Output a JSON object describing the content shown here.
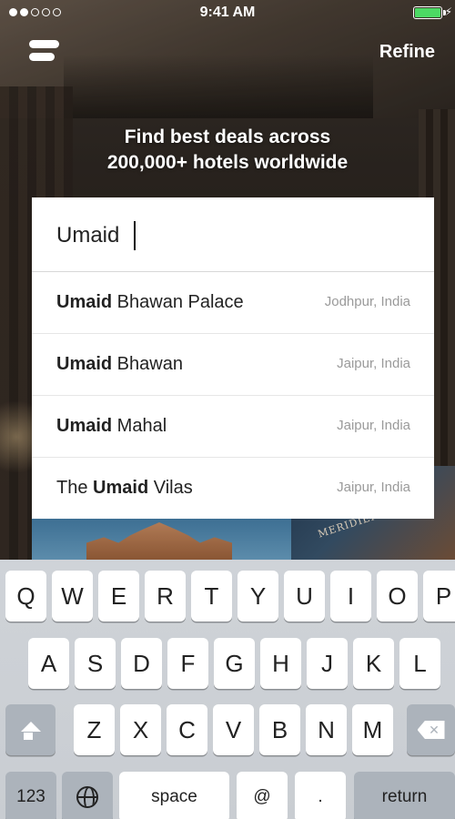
{
  "status_bar": {
    "signal_dots": [
      true,
      true,
      false,
      false,
      false
    ],
    "time": "9:41 AM",
    "battery_percent": 100,
    "battery_color": "#4cd964"
  },
  "nav": {
    "menu_icon": "menu-icon",
    "refine_label": "Refine"
  },
  "headline": {
    "line1": "Find best deals across",
    "line2": "200,000+ hotels worldwide"
  },
  "search": {
    "value": "Umaid",
    "placeholder": ""
  },
  "results": [
    {
      "prefix": "",
      "match": "Umaid",
      "suffix": " Bhawan Palace",
      "location": "Jodhpur, India"
    },
    {
      "prefix": "",
      "match": "Umaid",
      "suffix": " Bhawan",
      "location": "Jaipur, India"
    },
    {
      "prefix": "",
      "match": "Umaid",
      "suffix": " Mahal",
      "location": "Jaipur, India"
    },
    {
      "prefix": "The ",
      "match": "Umaid",
      "suffix": " Vilas",
      "location": "Jaipur, India"
    }
  ],
  "keyboard": {
    "row1": [
      "Q",
      "W",
      "E",
      "R",
      "T",
      "Y",
      "U",
      "I",
      "O",
      "P"
    ],
    "row2": [
      "A",
      "S",
      "D",
      "F",
      "G",
      "H",
      "J",
      "K",
      "L"
    ],
    "row3": [
      "Z",
      "X",
      "C",
      "V",
      "B",
      "N",
      "M"
    ],
    "shift_icon": "shift-icon",
    "delete_icon": "delete-icon",
    "numbers_label": "123",
    "globe_icon": "globe-icon",
    "space_label": "space",
    "at_label": "@",
    "dot_label": ".",
    "return_label": "return"
  }
}
